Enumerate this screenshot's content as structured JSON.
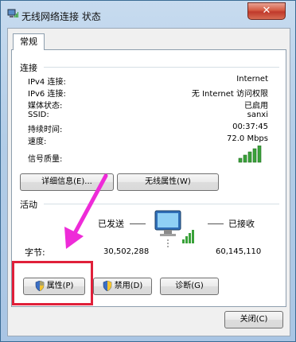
{
  "window": {
    "title": "无线网络连接 状态",
    "close_symbol": "✕"
  },
  "tabs": [
    {
      "label": "常规"
    }
  ],
  "connection": {
    "heading": "连接",
    "rows": [
      {
        "label": "IPv4 连接:",
        "value": "Internet"
      },
      {
        "label": "IPv6 连接:",
        "value": "无 Internet 访问权限"
      },
      {
        "label": "媒体状态:",
        "value": "已启用"
      },
      {
        "label": "SSID:",
        "value": "sanxi"
      },
      {
        "label": "持续时间:",
        "value": "00:37:45"
      },
      {
        "label": "速度:",
        "value": "72.0 Mbps"
      }
    ],
    "signal_label": "信号质量:",
    "signal_bars": 5,
    "details_button": "详细信息(E)...",
    "wireless_props_button": "无线属性(W)"
  },
  "activity": {
    "heading": "活动",
    "sent_label": "已发送",
    "received_label": "已接收",
    "bytes_label": "字节:",
    "bytes_sent": "30,502,288",
    "bytes_received": "60,145,110"
  },
  "actions": {
    "properties_button": "属性(P)",
    "disable_button": "禁用(D)",
    "diagnose_button": "诊断(G)"
  },
  "footer": {
    "close_button": "关闭(C)"
  },
  "colors": {
    "highlight": "#e0203a",
    "arrow": "#ee2bd8",
    "signal": "#3aa23a"
  },
  "icons": {
    "shield": "uac-shield-icon",
    "network": "network-computer-icon",
    "wifi": "wireless-signal-icon"
  }
}
